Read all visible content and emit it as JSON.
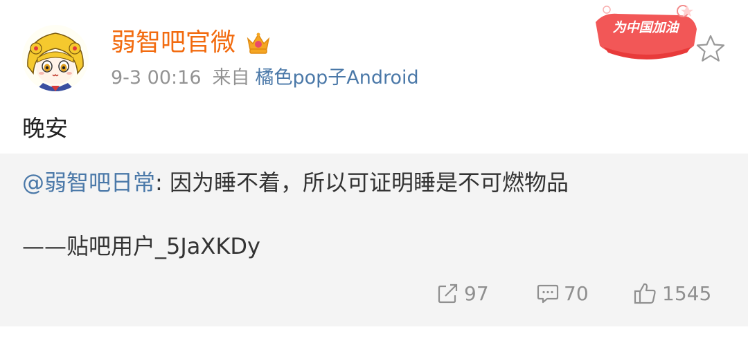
{
  "post": {
    "username": "弱智吧官微",
    "time": "9-3 00:16",
    "from_label": "来自",
    "source": "橘色pop子Android",
    "badge_text": "为中国加油",
    "text": "晚安"
  },
  "repost": {
    "mention": "@弱智吧日常",
    "text": ": 因为睡不着，所以可证明睡是不可燃物品",
    "attribution": "——贴吧用户_5JaXKDy"
  },
  "actions": {
    "repost_count": "97",
    "comment_count": "70",
    "like_count": "1545"
  },
  "colors": {
    "username": "#f26b0f",
    "link": "#4a78a8",
    "repost_bg": "#f4f4f4"
  }
}
